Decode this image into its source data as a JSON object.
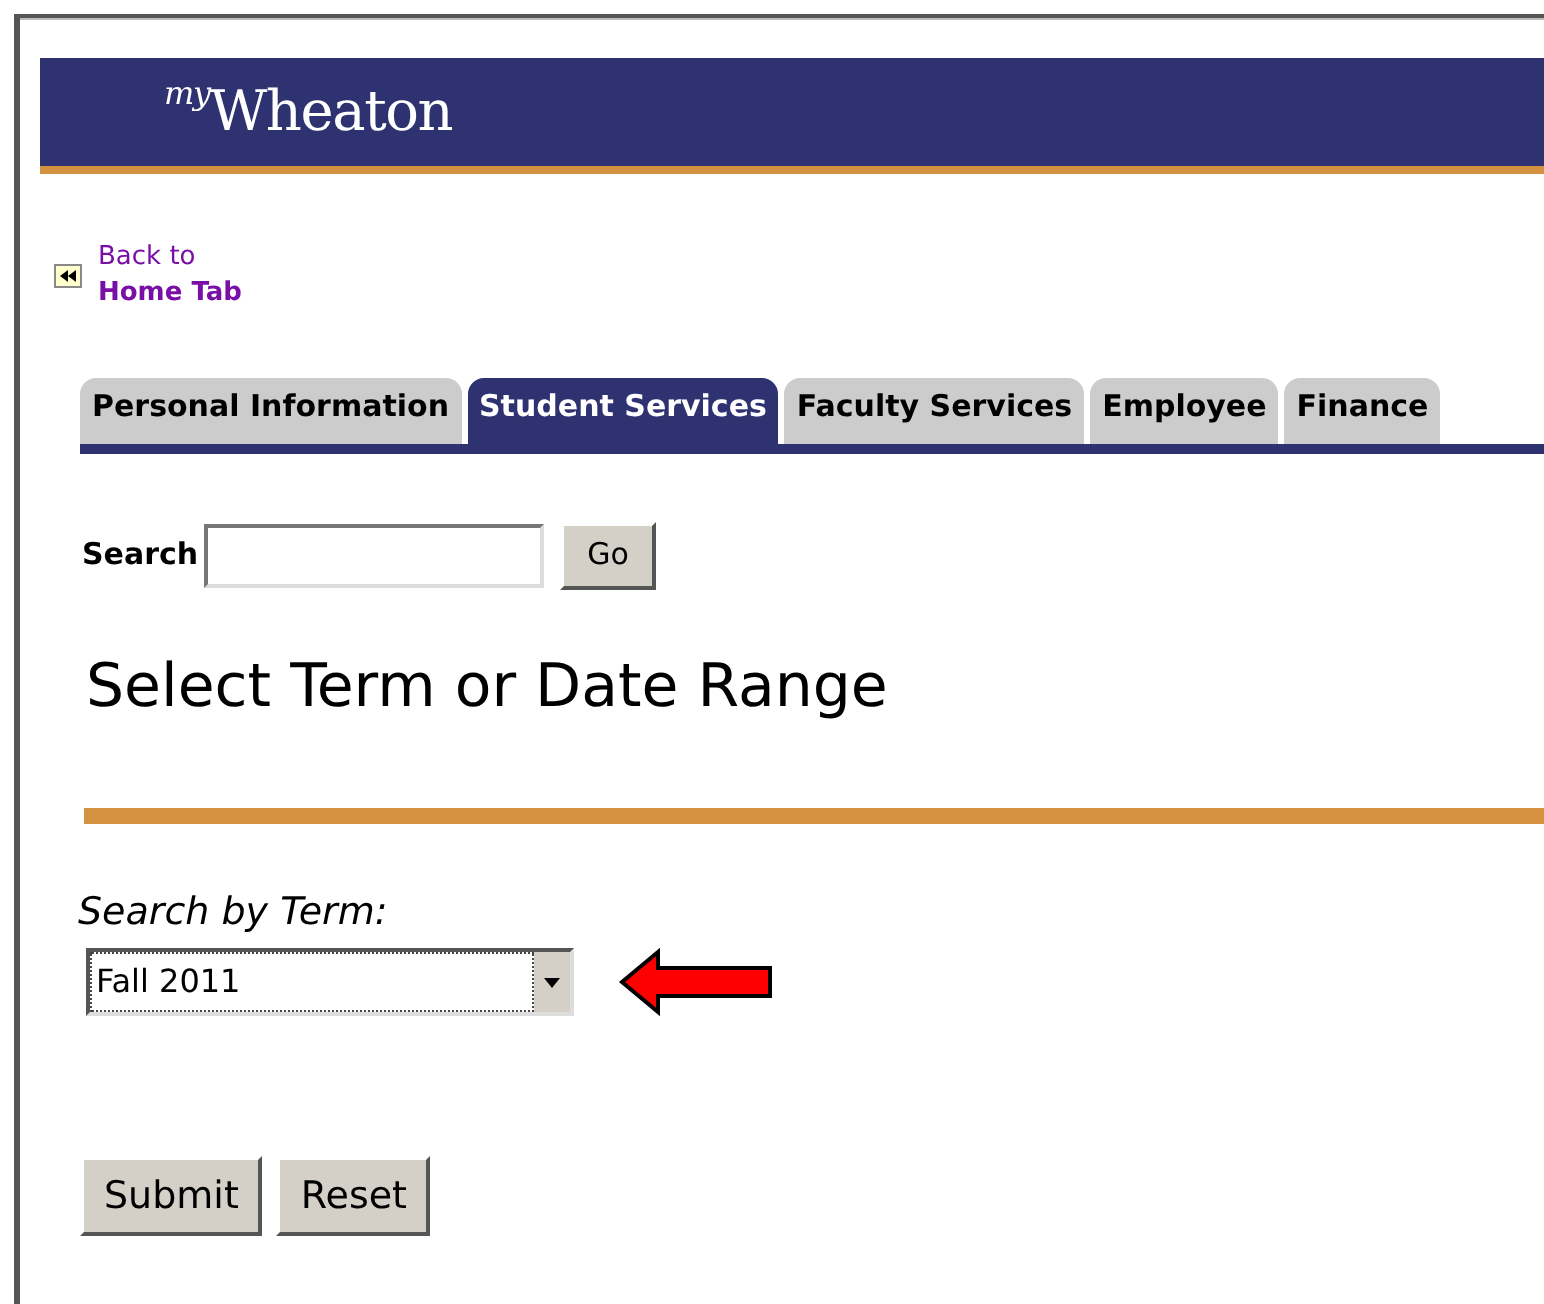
{
  "header": {
    "logo_prefix": "my",
    "logo_name": "Wheaton"
  },
  "back_link": {
    "line1": "Back to",
    "line2": "Home Tab"
  },
  "tabs": [
    {
      "label": "Personal Information",
      "selected": false
    },
    {
      "label": "Student Services",
      "selected": true
    },
    {
      "label": "Faculty Services",
      "selected": false
    },
    {
      "label": "Employee",
      "selected": false
    },
    {
      "label": "Finance",
      "selected": false
    }
  ],
  "search": {
    "label": "Search",
    "button": "Go"
  },
  "title": "Select Term or Date Range",
  "term": {
    "label": "Search by Term:",
    "value": "Fall 2011"
  },
  "buttons": [
    "Submit",
    "Reset"
  ]
}
